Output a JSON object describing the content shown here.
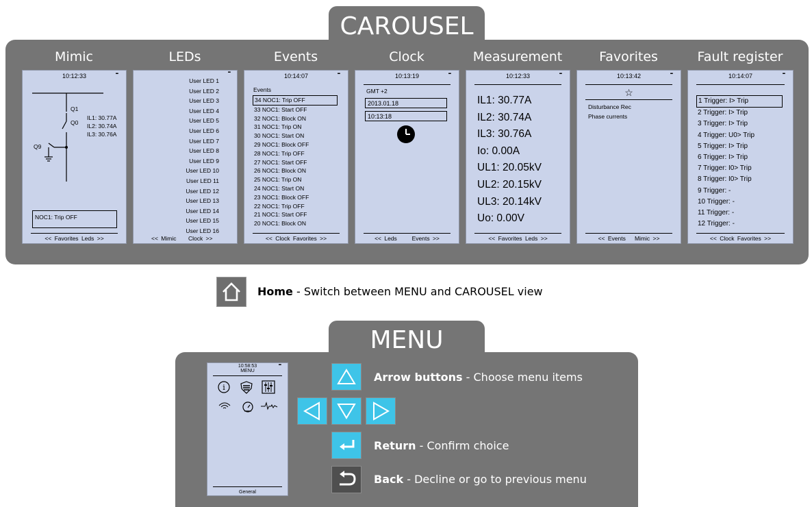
{
  "carousel": {
    "title": "CAROUSEL",
    "screens": [
      {
        "title": "Mimic",
        "time": "10:12:33",
        "ilvalues": [
          "IL1: 30.77A",
          "IL2: 30.74A",
          "IL3: 30.76A"
        ],
        "switch_labels": [
          "Q1",
          "Q0",
          "Q9"
        ],
        "status_box": "NOC1: Trip OFF",
        "footer_left": "<< Favorites",
        "footer_right": "Leds >>"
      },
      {
        "title": "LEDs",
        "leds": [
          "User LED 1",
          "User LED 2",
          "User LED 3",
          "User LED 4",
          "User LED 5",
          "User LED 6",
          "User LED 7",
          "User LED 8",
          "User LED 9",
          "User LED 10",
          "User LED 11",
          "User LED 12",
          "User LED 13",
          "User LED 14",
          "User LED 15",
          "User LED 16"
        ],
        "footer_left": "<< Mimic",
        "footer_right": "Clock >>"
      },
      {
        "title": "Events",
        "time": "10:14:07",
        "header": "Events",
        "events": [
          "34 NOC1: Trip OFF",
          "33 NOC1: Start OFF",
          "32 NOC1: Block ON",
          "31 NOC1: Trip ON",
          "30 NOC1: Start ON",
          "29 NOC1: Block OFF",
          "28 NOC1: Trip OFF",
          "27 NOC1: Start OFF",
          "26 NOC1: Block ON",
          "25 NOC1: Trip ON",
          "24 NOC1: Start ON",
          "23 NOC1: Block OFF",
          "22 NOC1: Trip OFF",
          "21 NOC1: Start OFF",
          "20 NOC1: Block ON"
        ],
        "footer_left": "<< Clock",
        "footer_right": "Favorites >>"
      },
      {
        "title": "Clock",
        "time": "10:13:19",
        "timezone": "GMT +2",
        "date": "2013.01.18",
        "clock_time": "10:13:18",
        "footer_left": "<< Leds",
        "footer_right": "Events >>"
      },
      {
        "title": "Measurement",
        "time": "10:12:33",
        "values": [
          "IL1: 30.77A",
          "IL2: 30.74A",
          "IL3: 30.76A",
          "Io: 0.00A",
          "UL1: 20.05kV",
          "UL2: 20.15kV",
          "UL3: 20.14kV",
          "Uo: 0.00V"
        ],
        "footer_left": "<< Favorites",
        "footer_right": "Leds >>"
      },
      {
        "title": "Favorites",
        "time": "10:13:42",
        "items": [
          "Disturbance Rec",
          "Phase currents"
        ],
        "footer_left": "<< Events",
        "footer_right": "Mimic >>"
      },
      {
        "title": "Fault register",
        "time": "10:14:07",
        "faults": [
          "1  Trigger: I> Trip",
          "2  Trigger: I> Trip",
          "3  Trigger: I> Trip",
          "4  Trigger: U0> Trip",
          "5  Trigger: I> Trip",
          "6  Trigger: I> Trip",
          "7  Trigger: I0> Trip",
          "8  Trigger: I0> Trip",
          "9  Trigger: -",
          "10 Trigger: -",
          "11 Trigger: -",
          "12 Trigger: -"
        ],
        "footer_left": "<< Clock",
        "footer_right": "Favorites >>"
      }
    ]
  },
  "home": {
    "bold": "Home",
    "text": " - Switch between MENU and CAROUSEL view",
    "icon": "home-icon"
  },
  "menu": {
    "title": "MENU",
    "screen": {
      "time": "10:58:53",
      "header": "MENU",
      "footer": "General"
    },
    "legend": [
      {
        "bold": "Arrow buttons",
        "text": " - Choose menu items"
      },
      {
        "bold": "Return",
        "text": " - Confirm choice"
      },
      {
        "bold": "Back",
        "text": " - Decline or go to previous menu"
      }
    ]
  },
  "colors": {
    "panel": "#757575",
    "screen": "#cad3ea",
    "button": "#3ec4e8"
  }
}
